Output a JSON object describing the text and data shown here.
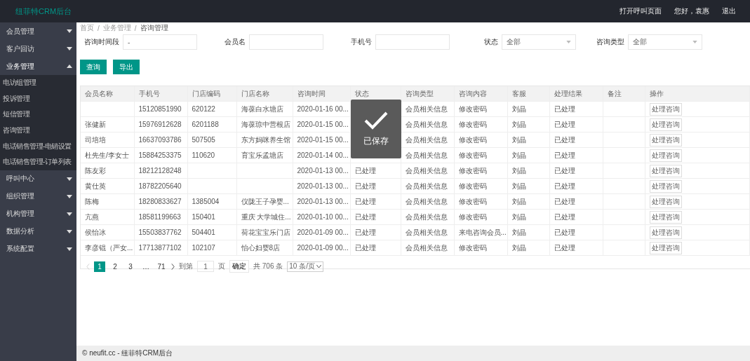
{
  "header": {
    "logo": "纽菲特CRM后台",
    "links": [
      "打开呼叫页面",
      "您好，袁惠",
      "退出"
    ]
  },
  "sidebar": {
    "items": [
      {
        "label": "会员管理",
        "expanded": false
      },
      {
        "label": "客户回访",
        "expanded": false
      },
      {
        "label": "业务管理",
        "expanded": true,
        "children": [
          {
            "label": "电访组管理"
          },
          {
            "label": "投诉管理"
          },
          {
            "label": "短信管理"
          },
          {
            "label": "咨询管理"
          },
          {
            "label": "电话销售管理-电销设置"
          },
          {
            "label": "电话销售管理-订单列表"
          }
        ]
      },
      {
        "label": "呼叫中心",
        "expanded": false
      },
      {
        "label": "组织管理",
        "expanded": false
      },
      {
        "label": "机构管理",
        "expanded": false
      },
      {
        "label": "数据分析",
        "expanded": false
      },
      {
        "label": "系统配置",
        "expanded": false
      }
    ]
  },
  "breadcrumb": [
    "首页",
    "/",
    "业务管理",
    "/",
    "咨询管理"
  ],
  "filters": [
    {
      "label": "咨询时间段",
      "kind": "input",
      "value": "-"
    },
    {
      "label": "会员名",
      "kind": "input"
    },
    {
      "label": "手机号",
      "kind": "input"
    },
    {
      "label": "状态",
      "kind": "select",
      "value": "全部"
    },
    {
      "label": "咨询类型",
      "kind": "select",
      "value": "全部"
    }
  ],
  "buttons": [
    "查询",
    "导出"
  ],
  "table": {
    "columns": [
      "会员名称",
      "手机号",
      "门店编码",
      "门店名称",
      "咨询时间",
      "状态",
      "咨询类型",
      "咨询内容",
      "客服",
      "处理结果",
      "备注",
      "操作"
    ],
    "rows": [
      {
        "cells": [
          "",
          "15120851990",
          "620122",
          "海葆白水塘店",
          "2020-01-16 00...",
          null,
          "会员相关信息",
          "修改密码",
          "刘晶",
          "已处理",
          ""
        ],
        "action": "处理咨询"
      },
      {
        "cells": [
          "张健新",
          "15976912628",
          "6201188",
          "海葆琼中营根店",
          "2020-01-15 00...",
          null,
          "会员相关信息",
          "修改密码",
          "刘晶",
          "已处理",
          ""
        ],
        "action": "处理咨询"
      },
      {
        "cells": [
          "司培培",
          "16637093786",
          "507505",
          "东方妈咪养生馆",
          "2020-01-15 00...",
          null,
          "会员相关信息",
          "修改密码",
          "刘晶",
          "已处理",
          ""
        ],
        "action": "处理咨询"
      },
      {
        "cells": [
          "杜先生/李女士",
          "15884253375",
          "110620",
          "育宝乐孟塘店",
          "2020-01-14 00...",
          null,
          "会员相关信息",
          "修改密码",
          "刘晶",
          "已处理",
          ""
        ],
        "action": "处理咨询"
      },
      {
        "cells": [
          "陈友彩",
          "18212128248",
          "",
          "",
          "2020-01-13 00...",
          "已处理",
          "会员相关信息",
          "修改密码",
          "刘晶",
          "已处理",
          ""
        ],
        "action": "处理咨询"
      },
      {
        "cells": [
          "黄仕英",
          "18782205640",
          "",
          "",
          "2020-01-13 00...",
          "已处理",
          "会员相关信息",
          "修改密码",
          "刘晶",
          "已处理",
          ""
        ],
        "action": "处理咨询"
      },
      {
        "cells": [
          "陈梅",
          "18280833627",
          "1385004",
          "仪陇王子孕婴...",
          "2020-01-13 00...",
          "已处理",
          "会员相关信息",
          "修改密码",
          "刘晶",
          "已处理",
          ""
        ],
        "action": "处理咨询"
      },
      {
        "cells": [
          "亢燕",
          "18581199663",
          "150401",
          "重庆 大学城住...",
          "2020-01-10 00...",
          "已处理",
          "会员相关信息",
          "修改密码",
          "刘晶",
          "已处理",
          ""
        ],
        "action": "处理咨询"
      },
      {
        "cells": [
          "侯怡冰",
          "15503837762",
          "504401",
          "荷花宝宝乐门店",
          "2020-01-09 00...",
          "已处理",
          "会员相关信息",
          "来电咨询会员...",
          "刘晶",
          "已处理",
          ""
        ],
        "action": "处理咨询"
      },
      {
        "cells": [
          "李彦锟（严女...",
          "17713877102",
          "102107",
          "怡心妇婴8店",
          "2020-01-09 00...",
          "已处理",
          "会员相关信息",
          "修改密码",
          "刘晶",
          "已处理",
          ""
        ],
        "action": "处理咨询"
      }
    ]
  },
  "pagination": {
    "pages": [
      {
        "label": "1",
        "selected": true
      },
      {
        "label": "2",
        "selected": false
      },
      {
        "label": "3",
        "selected": false
      },
      {
        "label": "…",
        "selected": false
      },
      {
        "label": "71",
        "selected": false
      }
    ],
    "goto_label": "到第",
    "goto_value": "1",
    "page_unit": "页",
    "confirm": "确定",
    "total": "共 706 条",
    "page_size": "10 条/页"
  },
  "toast": {
    "label": "已保存"
  },
  "footer": "© neufit.cc - 纽菲特CRM后台"
}
